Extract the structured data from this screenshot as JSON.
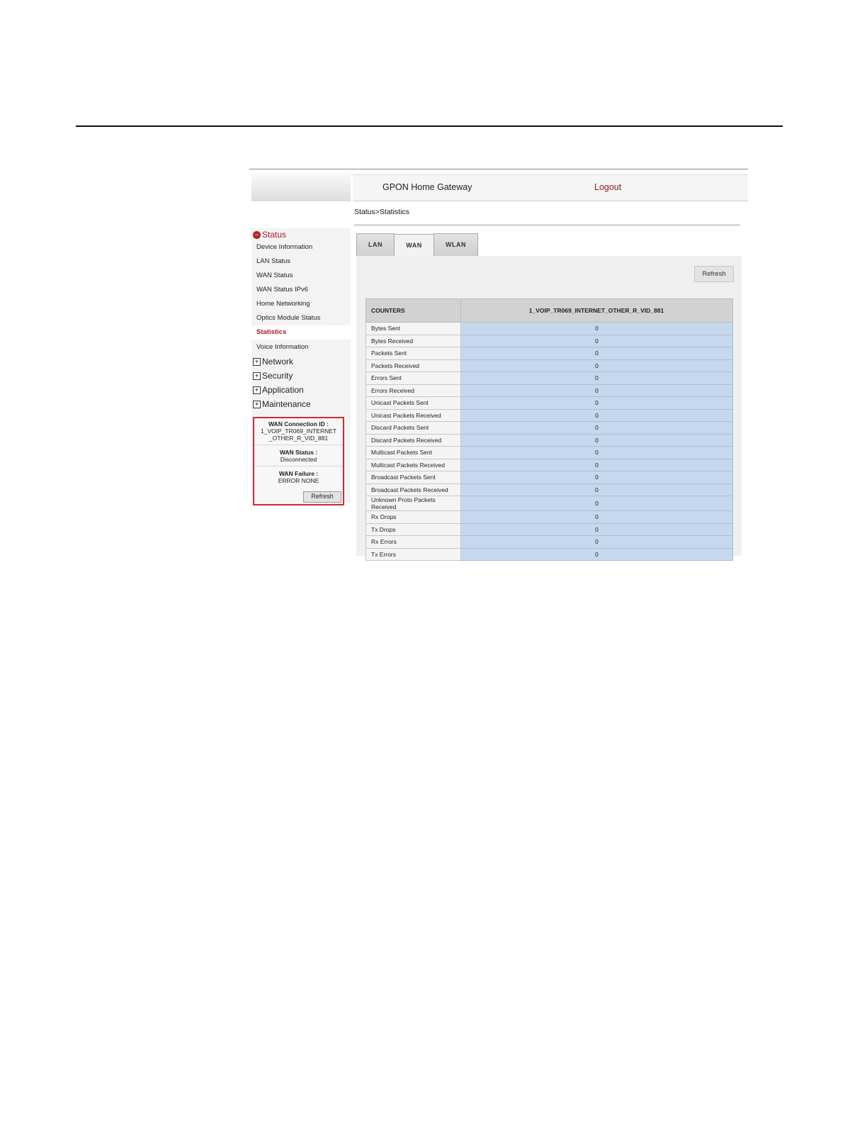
{
  "header": {
    "title": "GPON Home Gateway",
    "logout_label": "Logout"
  },
  "breadcrumb": "Status>Statistics",
  "sidebar": {
    "status_group": "Status",
    "status_items": [
      "Device Information",
      "LAN Status",
      "WAN Status",
      "WAN Status IPv6",
      "Home Networking",
      "Optics Module Status",
      "Statistics",
      "Voice Information"
    ],
    "active_item": "Statistics",
    "groups": [
      "Network",
      "Security",
      "Application",
      "Maintenance"
    ],
    "toggle_plus": "+",
    "toggle_minus": "−"
  },
  "wan_info": {
    "connection_id_label": "WAN Connection ID :",
    "connection_id_line1": "1_VOIP_TR069_INTERNET",
    "connection_id_line2": "_OTHER_R_VID_881",
    "status_label": "WAN Status :",
    "status_value": "Disconnected",
    "failure_label": "WAN Failure :",
    "failure_value": "ERROR NONE",
    "refresh_label": "Refresh"
  },
  "tabs": [
    {
      "label": "LAN",
      "active": false
    },
    {
      "label": "WAN",
      "active": true
    },
    {
      "label": "WLAN",
      "active": false
    }
  ],
  "panel": {
    "refresh_label": "Refresh"
  },
  "table": {
    "headers": [
      "COUNTERS",
      "1_VOIP_TR069_INTERNET_OTHER_R_VID_881"
    ],
    "rows": [
      [
        "Bytes Sent",
        "0"
      ],
      [
        "Bytes Received",
        "0"
      ],
      [
        "Packets Sent",
        "0"
      ],
      [
        "Packets Received",
        "0"
      ],
      [
        "Errors Sent",
        "0"
      ],
      [
        "Errors Received",
        "0"
      ],
      [
        "Unicast Packets Sent",
        "0"
      ],
      [
        "Unicast Packets Received",
        "0"
      ],
      [
        "Discard Packets Sent",
        "0"
      ],
      [
        "Discard Packets Received",
        "0"
      ],
      [
        "Multicast Packets Sent",
        "0"
      ],
      [
        "Multicast Packets Received",
        "0"
      ],
      [
        "Broadcast Packets Sent",
        "0"
      ],
      [
        "Broadcast Packets Received",
        "0"
      ],
      [
        "Unknown Proto Packets Received",
        "0"
      ],
      [
        "Rx Drops",
        "0"
      ],
      [
        "Tx Drops",
        "0"
      ],
      [
        "Rx Errors",
        "0"
      ],
      [
        "Tx Errors",
        "0"
      ]
    ]
  }
}
